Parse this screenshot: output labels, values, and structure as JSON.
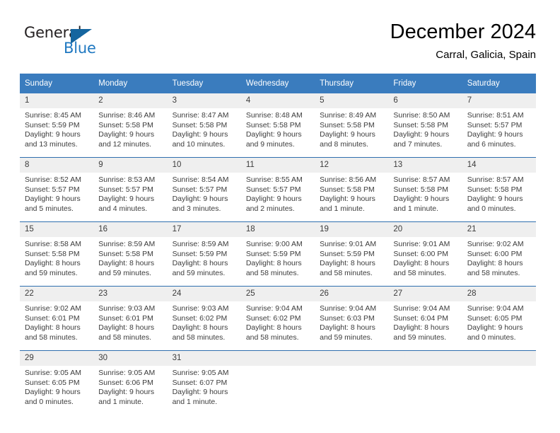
{
  "branding": {
    "name_dark": "General",
    "name_light": "Blue",
    "accent_color": "#1f78c1",
    "triangle_color": "#15659f"
  },
  "header": {
    "title": "December 2024",
    "subtitle": "Carral, Galicia, Spain"
  },
  "calendar": {
    "header_bg": "#3a7cbe",
    "daynum_bg": "#efefef",
    "weekday_headers": [
      "Sunday",
      "Monday",
      "Tuesday",
      "Wednesday",
      "Thursday",
      "Friday",
      "Saturday"
    ],
    "weeks": [
      [
        {
          "day": "1",
          "sunrise": "Sunrise: 8:45 AM",
          "sunset": "Sunset: 5:59 PM",
          "daylight_1": "Daylight: 9 hours",
          "daylight_2": "and 13 minutes."
        },
        {
          "day": "2",
          "sunrise": "Sunrise: 8:46 AM",
          "sunset": "Sunset: 5:58 PM",
          "daylight_1": "Daylight: 9 hours",
          "daylight_2": "and 12 minutes."
        },
        {
          "day": "3",
          "sunrise": "Sunrise: 8:47 AM",
          "sunset": "Sunset: 5:58 PM",
          "daylight_1": "Daylight: 9 hours",
          "daylight_2": "and 10 minutes."
        },
        {
          "day": "4",
          "sunrise": "Sunrise: 8:48 AM",
          "sunset": "Sunset: 5:58 PM",
          "daylight_1": "Daylight: 9 hours",
          "daylight_2": "and 9 minutes."
        },
        {
          "day": "5",
          "sunrise": "Sunrise: 8:49 AM",
          "sunset": "Sunset: 5:58 PM",
          "daylight_1": "Daylight: 9 hours",
          "daylight_2": "and 8 minutes."
        },
        {
          "day": "6",
          "sunrise": "Sunrise: 8:50 AM",
          "sunset": "Sunset: 5:58 PM",
          "daylight_1": "Daylight: 9 hours",
          "daylight_2": "and 7 minutes."
        },
        {
          "day": "7",
          "sunrise": "Sunrise: 8:51 AM",
          "sunset": "Sunset: 5:57 PM",
          "daylight_1": "Daylight: 9 hours",
          "daylight_2": "and 6 minutes."
        }
      ],
      [
        {
          "day": "8",
          "sunrise": "Sunrise: 8:52 AM",
          "sunset": "Sunset: 5:57 PM",
          "daylight_1": "Daylight: 9 hours",
          "daylight_2": "and 5 minutes."
        },
        {
          "day": "9",
          "sunrise": "Sunrise: 8:53 AM",
          "sunset": "Sunset: 5:57 PM",
          "daylight_1": "Daylight: 9 hours",
          "daylight_2": "and 4 minutes."
        },
        {
          "day": "10",
          "sunrise": "Sunrise: 8:54 AM",
          "sunset": "Sunset: 5:57 PM",
          "daylight_1": "Daylight: 9 hours",
          "daylight_2": "and 3 minutes."
        },
        {
          "day": "11",
          "sunrise": "Sunrise: 8:55 AM",
          "sunset": "Sunset: 5:57 PM",
          "daylight_1": "Daylight: 9 hours",
          "daylight_2": "and 2 minutes."
        },
        {
          "day": "12",
          "sunrise": "Sunrise: 8:56 AM",
          "sunset": "Sunset: 5:58 PM",
          "daylight_1": "Daylight: 9 hours",
          "daylight_2": "and 1 minute."
        },
        {
          "day": "13",
          "sunrise": "Sunrise: 8:57 AM",
          "sunset": "Sunset: 5:58 PM",
          "daylight_1": "Daylight: 9 hours",
          "daylight_2": "and 1 minute."
        },
        {
          "day": "14",
          "sunrise": "Sunrise: 8:57 AM",
          "sunset": "Sunset: 5:58 PM",
          "daylight_1": "Daylight: 9 hours",
          "daylight_2": "and 0 minutes."
        }
      ],
      [
        {
          "day": "15",
          "sunrise": "Sunrise: 8:58 AM",
          "sunset": "Sunset: 5:58 PM",
          "daylight_1": "Daylight: 8 hours",
          "daylight_2": "and 59 minutes."
        },
        {
          "day": "16",
          "sunrise": "Sunrise: 8:59 AM",
          "sunset": "Sunset: 5:58 PM",
          "daylight_1": "Daylight: 8 hours",
          "daylight_2": "and 59 minutes."
        },
        {
          "day": "17",
          "sunrise": "Sunrise: 8:59 AM",
          "sunset": "Sunset: 5:59 PM",
          "daylight_1": "Daylight: 8 hours",
          "daylight_2": "and 59 minutes."
        },
        {
          "day": "18",
          "sunrise": "Sunrise: 9:00 AM",
          "sunset": "Sunset: 5:59 PM",
          "daylight_1": "Daylight: 8 hours",
          "daylight_2": "and 58 minutes."
        },
        {
          "day": "19",
          "sunrise": "Sunrise: 9:01 AM",
          "sunset": "Sunset: 5:59 PM",
          "daylight_1": "Daylight: 8 hours",
          "daylight_2": "and 58 minutes."
        },
        {
          "day": "20",
          "sunrise": "Sunrise: 9:01 AM",
          "sunset": "Sunset: 6:00 PM",
          "daylight_1": "Daylight: 8 hours",
          "daylight_2": "and 58 minutes."
        },
        {
          "day": "21",
          "sunrise": "Sunrise: 9:02 AM",
          "sunset": "Sunset: 6:00 PM",
          "daylight_1": "Daylight: 8 hours",
          "daylight_2": "and 58 minutes."
        }
      ],
      [
        {
          "day": "22",
          "sunrise": "Sunrise: 9:02 AM",
          "sunset": "Sunset: 6:01 PM",
          "daylight_1": "Daylight: 8 hours",
          "daylight_2": "and 58 minutes."
        },
        {
          "day": "23",
          "sunrise": "Sunrise: 9:03 AM",
          "sunset": "Sunset: 6:01 PM",
          "daylight_1": "Daylight: 8 hours",
          "daylight_2": "and 58 minutes."
        },
        {
          "day": "24",
          "sunrise": "Sunrise: 9:03 AM",
          "sunset": "Sunset: 6:02 PM",
          "daylight_1": "Daylight: 8 hours",
          "daylight_2": "and 58 minutes."
        },
        {
          "day": "25",
          "sunrise": "Sunrise: 9:04 AM",
          "sunset": "Sunset: 6:02 PM",
          "daylight_1": "Daylight: 8 hours",
          "daylight_2": "and 58 minutes."
        },
        {
          "day": "26",
          "sunrise": "Sunrise: 9:04 AM",
          "sunset": "Sunset: 6:03 PM",
          "daylight_1": "Daylight: 8 hours",
          "daylight_2": "and 59 minutes."
        },
        {
          "day": "27",
          "sunrise": "Sunrise: 9:04 AM",
          "sunset": "Sunset: 6:04 PM",
          "daylight_1": "Daylight: 8 hours",
          "daylight_2": "and 59 minutes."
        },
        {
          "day": "28",
          "sunrise": "Sunrise: 9:04 AM",
          "sunset": "Sunset: 6:05 PM",
          "daylight_1": "Daylight: 9 hours",
          "daylight_2": "and 0 minutes."
        }
      ],
      [
        {
          "day": "29",
          "sunrise": "Sunrise: 9:05 AM",
          "sunset": "Sunset: 6:05 PM",
          "daylight_1": "Daylight: 9 hours",
          "daylight_2": "and 0 minutes."
        },
        {
          "day": "30",
          "sunrise": "Sunrise: 9:05 AM",
          "sunset": "Sunset: 6:06 PM",
          "daylight_1": "Daylight: 9 hours",
          "daylight_2": "and 1 minute."
        },
        {
          "day": "31",
          "sunrise": "Sunrise: 9:05 AM",
          "sunset": "Sunset: 6:07 PM",
          "daylight_1": "Daylight: 9 hours",
          "daylight_2": "and 1 minute."
        },
        {
          "day": "",
          "sunrise": "",
          "sunset": "",
          "daylight_1": "",
          "daylight_2": ""
        },
        {
          "day": "",
          "sunrise": "",
          "sunset": "",
          "daylight_1": "",
          "daylight_2": ""
        },
        {
          "day": "",
          "sunrise": "",
          "sunset": "",
          "daylight_1": "",
          "daylight_2": ""
        },
        {
          "day": "",
          "sunrise": "",
          "sunset": "",
          "daylight_1": "",
          "daylight_2": ""
        }
      ]
    ]
  }
}
